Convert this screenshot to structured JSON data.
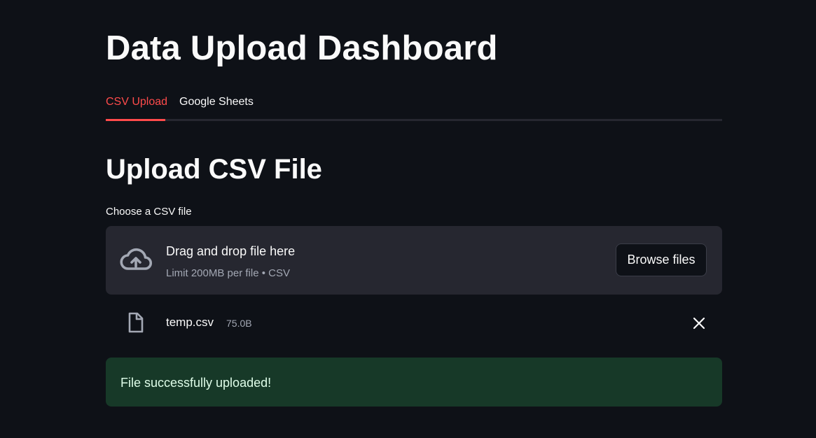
{
  "page": {
    "title": "Data Upload Dashboard"
  },
  "tabs": [
    {
      "label": "CSV Upload",
      "active": true
    },
    {
      "label": "Google Sheets",
      "active": false
    }
  ],
  "section": {
    "title": "Upload CSV File"
  },
  "uploader": {
    "label": "Choose a CSV file",
    "drop_title": "Drag and drop file here",
    "limit_text": "Limit 200MB per file • CSV",
    "browse_label": "Browse files",
    "icon": "cloud-upload-icon"
  },
  "uploaded_file": {
    "name": "temp.csv",
    "size": "75.0B",
    "icon": "file-icon",
    "remove_icon": "close-icon"
  },
  "alert": {
    "type": "success",
    "message": "File successfully uploaded!"
  },
  "colors": {
    "background": "#0e1117",
    "accent": "#ff4b4b",
    "dropzone": "#262730",
    "success_bg": "#173928",
    "success_text": "#dffde9"
  }
}
